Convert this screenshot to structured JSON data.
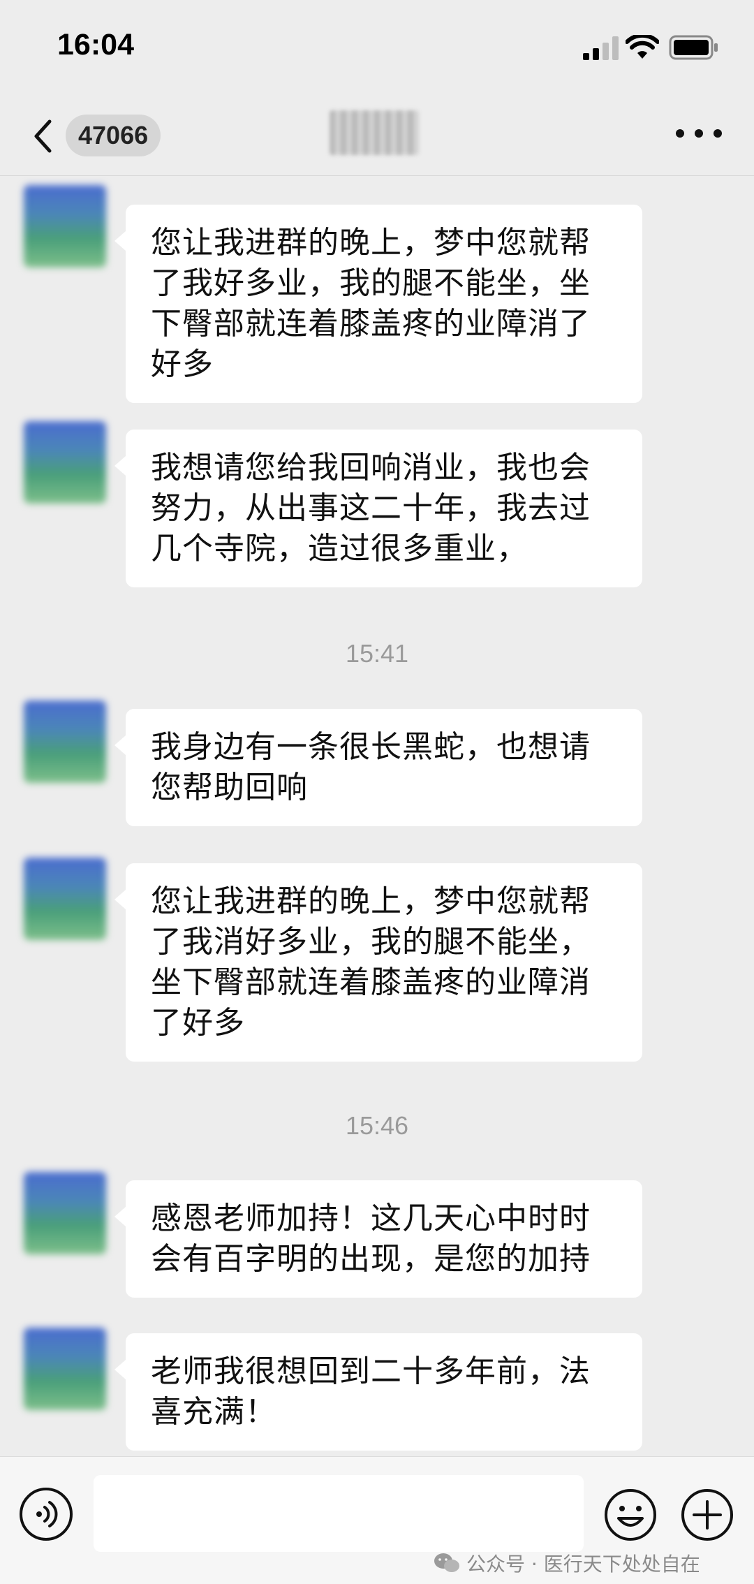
{
  "status_bar": {
    "time": "16:04",
    "icons": [
      "signal-icon",
      "wifi-icon",
      "battery-icon"
    ]
  },
  "nav": {
    "back_icon": "chevron-left-icon",
    "unread_count": "47066",
    "more_icon": "more-horizontal-icon"
  },
  "messages": [
    {
      "type": "text",
      "text": "您让我进群的晚上，梦中您就帮了我好多业，我的腿不能坐，坐下臀部就连着膝盖疼的业障消了好多"
    },
    {
      "type": "text",
      "text": "我想请您给我回响消业，我也会努力，从出事这二十年，我去过几个寺院，造过很多重业，"
    },
    {
      "type": "time",
      "text": "15:41"
    },
    {
      "type": "text",
      "text": "我身边有一条很长黑蛇，也想请您帮助回响"
    },
    {
      "type": "text",
      "text": "您让我进群的晚上，梦中您就帮了我消好多业，我的腿不能坐，坐下臀部就连着膝盖疼的业障消了好多"
    },
    {
      "type": "time",
      "text": "15:46"
    },
    {
      "type": "text",
      "text": "感恩老师加持！这几天心中时时会有百字明的出现，是您的加持"
    },
    {
      "type": "text",
      "text": "老师我很想回到二十多年前，法喜充满！"
    }
  ],
  "input_bar": {
    "voice_icon": "voice-icon",
    "input_value": "",
    "emoji_icon": "emoji-icon",
    "plus_icon": "plus-icon"
  },
  "watermark": {
    "text": "公众号 · 医行天下处处自在",
    "icon": "wechat-logo-icon"
  },
  "colors": {
    "background": "#ededed",
    "bubble": "#ffffff",
    "timestamp": "#9a9a9a"
  }
}
